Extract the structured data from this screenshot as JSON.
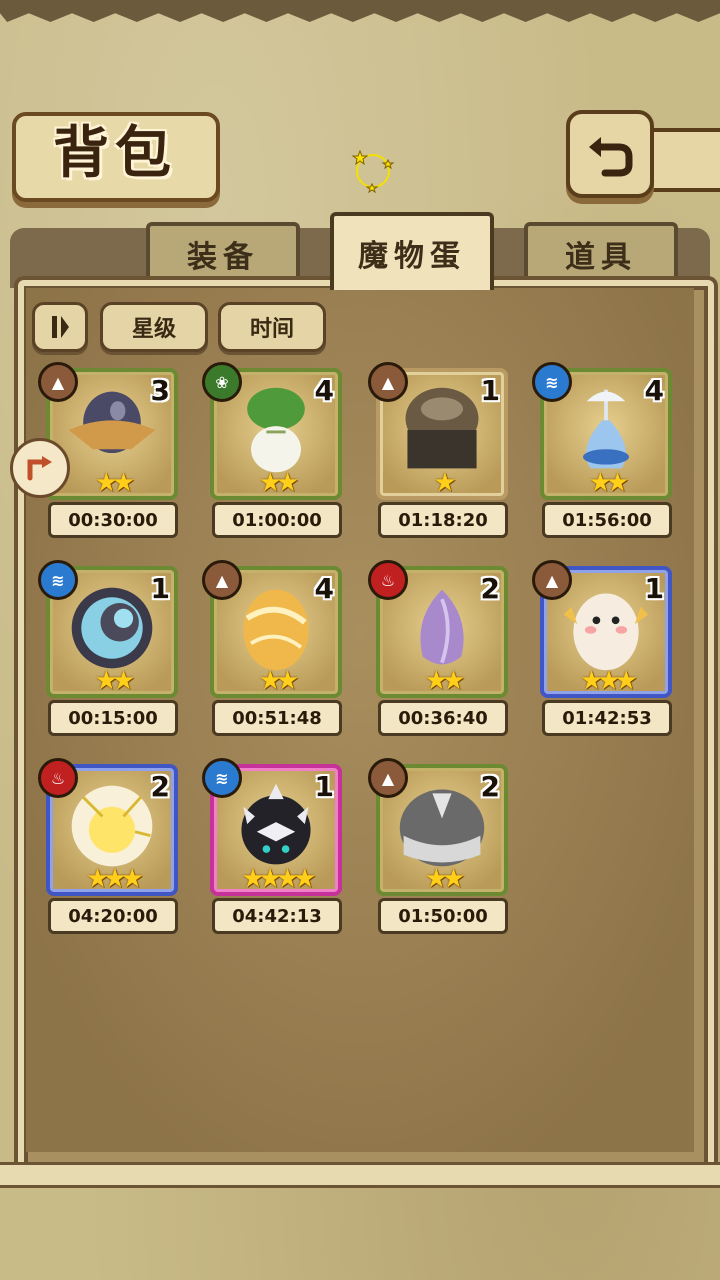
{
  "header": {
    "title": "背包"
  },
  "tabs": [
    {
      "label": "装备",
      "active": false
    },
    {
      "label": "魔物蛋",
      "active": true
    },
    {
      "label": "道具",
      "active": false
    }
  ],
  "sort": {
    "star_label": "星级",
    "time_label": "时间"
  },
  "eggs": [
    {
      "element": "earth",
      "count": "3",
      "stars": "★★",
      "time": "00:30:00",
      "frame": "green",
      "art": "dark-egg-with-cloth"
    },
    {
      "element": "grass",
      "count": "4",
      "stars": "★★",
      "time": "01:00:00",
      "frame": "green",
      "art": "turnip"
    },
    {
      "element": "earth",
      "count": "1",
      "stars": "★",
      "time": "01:18:20",
      "frame": "tan",
      "art": "helmet-egg"
    },
    {
      "element": "water",
      "count": "4",
      "stars": "★★",
      "time": "01:56:00",
      "frame": "green",
      "art": "blue-flask"
    },
    {
      "element": "water",
      "count": "1",
      "stars": "★★",
      "time": "00:15:00",
      "frame": "green",
      "art": "spiral-shell"
    },
    {
      "element": "earth",
      "count": "4",
      "stars": "★★",
      "time": "00:51:48",
      "frame": "green",
      "art": "golden-swirl-egg"
    },
    {
      "element": "fire",
      "count": "2",
      "stars": "★★",
      "time": "00:36:40",
      "frame": "green",
      "art": "purple-bud"
    },
    {
      "element": "earth",
      "count": "1",
      "stars": "★★★",
      "time": "01:42:53",
      "frame": "blue",
      "art": "fluffy-creature"
    },
    {
      "element": "fire",
      "count": "2",
      "stars": "★★★",
      "time": "04:20:00",
      "frame": "blue",
      "art": "sun-egg"
    },
    {
      "element": "water",
      "count": "1",
      "stars": "★★★★",
      "time": "04:42:13",
      "frame": "pink",
      "art": "spiked-black-egg"
    },
    {
      "element": "earth",
      "count": "2",
      "stars": "★★",
      "time": "01:50:00",
      "frame": "green",
      "art": "grey-hair-egg"
    }
  ],
  "colors": {
    "earth": "#8a5a3a",
    "grass": "#3b7a2a",
    "water": "#2a7ad0",
    "fire": "#c02020",
    "star": "#ffcf1a",
    "frame_green": "#6b8a32",
    "frame_blue": "#3f56c4",
    "frame_pink": "#c7319a"
  },
  "icons": {
    "back": "back-arrow-icon",
    "fairy": "fairy-ring-icon",
    "filter": "filter-icon",
    "side": "side-arrow-icon"
  }
}
